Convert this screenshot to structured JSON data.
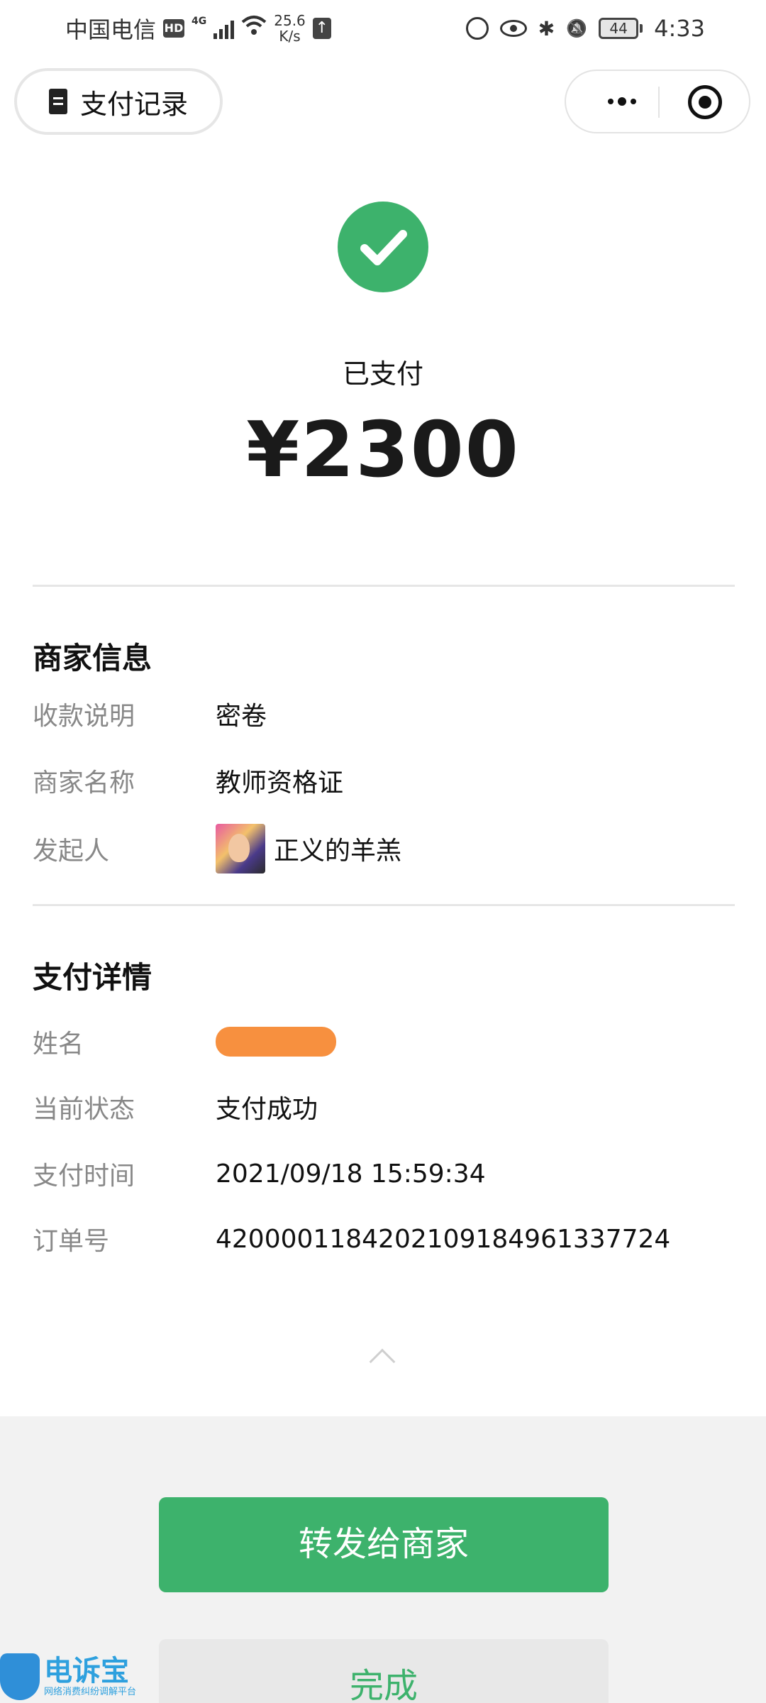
{
  "status_bar": {
    "carrier": "中国电信",
    "hd": "HD",
    "network": "4G",
    "speed_value": "25.6",
    "speed_unit": "K/s",
    "upload": "↑",
    "battery": "44",
    "time": "4:33",
    "bluetooth": "✱",
    "mute": "🔕"
  },
  "nav": {
    "record_label": "支付记录"
  },
  "payment": {
    "status_label": "已支付",
    "amount": "¥2300"
  },
  "merchant_info": {
    "title": "商家信息",
    "rows": [
      {
        "key": "收款说明",
        "value": "密卷"
      },
      {
        "key": "商家名称",
        "value": "教师资格证"
      },
      {
        "key": "发起人",
        "value": "正义的羊羔"
      }
    ]
  },
  "payment_details": {
    "title": "支付详情",
    "rows": [
      {
        "key": "姓名",
        "value": ""
      },
      {
        "key": "当前状态",
        "value": "支付成功"
      },
      {
        "key": "支付时间",
        "value": "2021/09/18 15:59:34"
      },
      {
        "key": "订单号",
        "value": "4200001184202109184961337724"
      }
    ]
  },
  "buttons": {
    "forward": "转发给商家",
    "done": "完成"
  },
  "watermark": {
    "title": "电诉宝",
    "subtitle": "网络消费纠纷调解平台"
  },
  "colors": {
    "accent": "#3db26c",
    "redaction": "#f7903f",
    "watermark": "#2ea0de"
  }
}
